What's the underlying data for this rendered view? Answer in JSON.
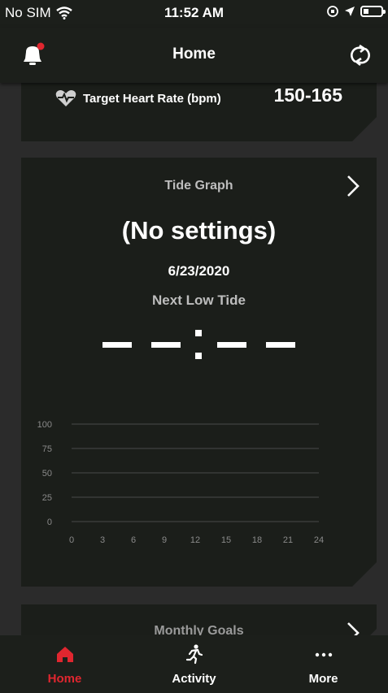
{
  "status": {
    "carrier": "No SIM",
    "time": "11:52 AM"
  },
  "header": {
    "title": "Home"
  },
  "heart_rate": {
    "label": "Target Heart Rate (bpm)",
    "value": "150-165"
  },
  "tide": {
    "title": "Tide Graph",
    "status": "(No settings)",
    "date": "6/23/2020",
    "next_label": "Next Low Tide"
  },
  "chart_data": {
    "type": "line",
    "x_ticks": [
      "0",
      "3",
      "6",
      "9",
      "12",
      "15",
      "18",
      "21",
      "24"
    ],
    "y_ticks": [
      "100",
      "75",
      "50",
      "25",
      "0"
    ],
    "xlim": [
      0,
      24
    ],
    "ylim": [
      0,
      100
    ],
    "series": [],
    "grid": true
  },
  "monthly": {
    "title": "Monthly Goals"
  },
  "tabs": [
    {
      "label": "Home",
      "icon": "home-icon",
      "active": true
    },
    {
      "label": "Activity",
      "icon": "running-icon",
      "active": false
    },
    {
      "label": "More",
      "icon": "more-icon",
      "active": false
    }
  ],
  "colors": {
    "accent": "#e0262f",
    "background": "#2b2b2b",
    "card": "#1b1e1a",
    "bar": "#1c1f1b"
  }
}
